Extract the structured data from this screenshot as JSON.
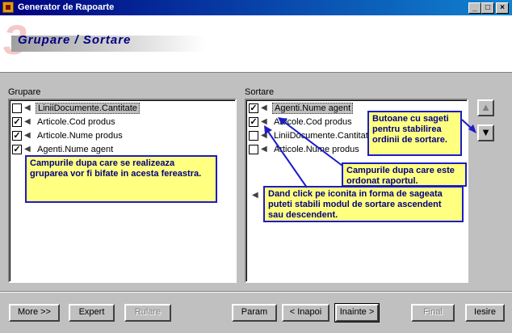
{
  "window": {
    "title": "Generator de Rapoarte",
    "min": "_",
    "max": "□",
    "close": "×"
  },
  "header": {
    "step": "3",
    "title": "Grupare / Sortare"
  },
  "grupare": {
    "label": "Grupare",
    "items": [
      {
        "label": "LiniiDocumente.Cantitate",
        "checked": ""
      },
      {
        "label": "Articole.Cod produs",
        "checked": "✓"
      },
      {
        "label": "Articole.Nume produs",
        "checked": "✓"
      },
      {
        "label": "Agenti.Nume agent",
        "checked": "✓"
      }
    ]
  },
  "sortare": {
    "label": "Sortare",
    "items": [
      {
        "label": "Agenti.Nume agent",
        "checked": "✓"
      },
      {
        "label": "Articole.Cod produs",
        "checked": "✓"
      },
      {
        "label": "LiniiDocumente.Cantitate",
        "checked": ""
      },
      {
        "label": "Articole.Nume produs",
        "checked": ""
      }
    ]
  },
  "callouts": {
    "grupare": "Campurile dupa care se realizeaza gruparea vor fi bifate in acesta fereastra.",
    "butoane": "Butoane cu sageti pentru stabilirea ordinii de sortare.",
    "sortare": "Campurile dupa care este ordonat raportul.",
    "iconita": "Dand click pe iconita in forma de sageata puteti stabili modul de sortare ascendent sau descendent."
  },
  "buttons": {
    "more": "More >>",
    "expert": "Expert",
    "rulare": "Rulare",
    "param": "Param",
    "inapoi": "< Inapoi",
    "inainte": "Inainte >",
    "final": "Final",
    "iesire": "Iesire"
  },
  "icons": {
    "up": "up-arrow-icon",
    "down": "down-arrow-icon",
    "sort": "sort-arrow-icon"
  },
  "colors": {
    "callout_bg": "#ffff80",
    "callout_border": "#1c1cc8",
    "title_bar": "#000080"
  }
}
